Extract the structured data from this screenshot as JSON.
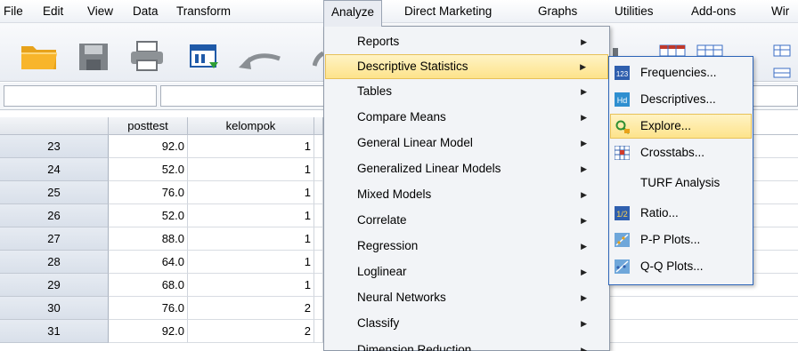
{
  "menubar": {
    "items": [
      {
        "label": "File",
        "underline": "F"
      },
      {
        "label": "Edit",
        "underline": "E"
      },
      {
        "label": "View",
        "underline": "V"
      },
      {
        "label": "Data",
        "underline": "D"
      },
      {
        "label": "Transform",
        "underline": "T"
      },
      {
        "label": "Analyze",
        "underline": "A"
      },
      {
        "label": "Direct Marketing",
        "underline": "M"
      },
      {
        "label": "Graphs",
        "underline": "G"
      },
      {
        "label": "Utilities",
        "underline": "U"
      },
      {
        "label": "Add-ons",
        "underline": "o"
      },
      {
        "label": "Wir",
        "underline": "W"
      }
    ]
  },
  "toolbar": {
    "icons": [
      "open-folder-icon",
      "save-icon",
      "print-icon",
      "dialog-recall-icon",
      "undo-icon"
    ]
  },
  "grid": {
    "columns": [
      "posttest",
      "kelompok"
    ],
    "rows": [
      {
        "row": "23",
        "posttest": "92.0",
        "kelompok": "1"
      },
      {
        "row": "24",
        "posttest": "52.0",
        "kelompok": "1"
      },
      {
        "row": "25",
        "posttest": "76.0",
        "kelompok": "1"
      },
      {
        "row": "26",
        "posttest": "52.0",
        "kelompok": "1"
      },
      {
        "row": "27",
        "posttest": "88.0",
        "kelompok": "1"
      },
      {
        "row": "28",
        "posttest": "64.0",
        "kelompok": "1"
      },
      {
        "row": "29",
        "posttest": "68.0",
        "kelompok": "1"
      },
      {
        "row": "30",
        "posttest": "76.0",
        "kelompok": "2"
      },
      {
        "row": "31",
        "posttest": "92.0",
        "kelompok": "2"
      }
    ]
  },
  "analyze_menu": {
    "items": [
      {
        "label": "Reports",
        "underline": "p"
      },
      {
        "label": "Descriptive Statistics",
        "underline": "E"
      },
      {
        "label": "Tables",
        "underline": "b"
      },
      {
        "label": "Compare Means",
        "underline": "M"
      },
      {
        "label": "General Linear Model",
        "underline": "G"
      },
      {
        "label": "Generalized Linear Models",
        "underline": "z"
      },
      {
        "label": "Mixed Models",
        "underline": "X"
      },
      {
        "label": "Correlate",
        "underline": "C"
      },
      {
        "label": "Regression",
        "underline": "R"
      },
      {
        "label": "Loglinear",
        "underline": "o"
      },
      {
        "label": "Neural Networks",
        "underline": "w"
      },
      {
        "label": "Classify",
        "underline": "F"
      },
      {
        "label": "Dimension Reduction",
        "underline": "D"
      }
    ],
    "highlighted_index": 1
  },
  "descriptive_submenu": {
    "items": [
      {
        "label": "Frequencies...",
        "underline": "F",
        "icon": "frequencies-icon"
      },
      {
        "label": "Descriptives...",
        "underline": "D",
        "icon": "descriptives-icon"
      },
      {
        "label": "Explore...",
        "underline": "E",
        "icon": "explore-icon"
      },
      {
        "label": "Crosstabs...",
        "underline": "C",
        "icon": "crosstabs-icon"
      },
      {
        "label": "TURF Analysis",
        "underline": "",
        "icon": ""
      },
      {
        "label": "Ratio...",
        "underline": "R",
        "icon": "ratio-icon"
      },
      {
        "label": "P-P Plots...",
        "underline": "P",
        "icon": "pp-plots-icon"
      },
      {
        "label": "Q-Q Plots...",
        "underline": "Q",
        "icon": "qq-plots-icon"
      }
    ],
    "highlighted_index": 2
  },
  "colors": {
    "highlight": "#fde38b",
    "submenu_border": "#2c64b8",
    "rowheader": "#dde3ec"
  }
}
